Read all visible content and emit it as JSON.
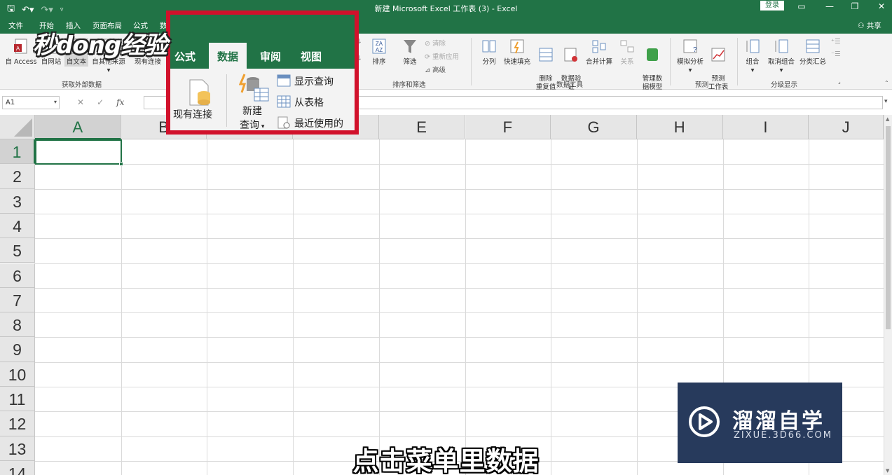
{
  "window": {
    "title": "新建 Microsoft Excel 工作表 (3)  -  Excel",
    "login_label": "登录"
  },
  "tabs": [
    "文件",
    "开始",
    "插入",
    "页面布局",
    "公式",
    "数据",
    "审阅",
    "视图"
  ],
  "share_label": "共享",
  "ribbon": {
    "get_external": {
      "buttons": [
        "自 Access",
        "自网站",
        "自文本",
        "自其他来源",
        "现有连接"
      ],
      "group_label": "获取外部数据"
    },
    "sort_filter": {
      "sort": "排序",
      "filter": "筛选",
      "clear": "清除",
      "reapply": "重新应用",
      "advanced": "高级",
      "group_label": "排序和筛选"
    },
    "data_tools": {
      "buttons": [
        "分列",
        "快速填充",
        "删除\n重复值",
        "数据验\n证",
        "合并计算",
        "关系",
        "管理数\n据模型"
      ],
      "group_label": "数据工具"
    },
    "forecast": {
      "buttons": [
        "模拟分析",
        "预测\n工作表"
      ],
      "group_label": "预测"
    },
    "outline": {
      "buttons": [
        "组合",
        "取消组合",
        "分类汇总"
      ],
      "group_label": "分级显示"
    }
  },
  "formula_bar": {
    "name_box": "A1",
    "fx": "fx",
    "value": ""
  },
  "sheet": {
    "columns": [
      "A",
      "B",
      "C",
      "D",
      "E",
      "F",
      "G",
      "H",
      "I",
      "J"
    ],
    "rows": [
      "1",
      "2",
      "3",
      "4",
      "5",
      "6",
      "7",
      "8",
      "9",
      "10",
      "11",
      "12",
      "13",
      "14"
    ],
    "active_cell": "A1"
  },
  "zoom": {
    "tabs": [
      "公式",
      "数据",
      "审阅",
      "视图"
    ],
    "existing_connections": "现有连接",
    "new_query_line1": "新建",
    "new_query_line2": "查询",
    "show_queries": "显示查询",
    "from_table": "从表格",
    "recent_sources": "最近使用的"
  },
  "watermarks": {
    "top_left": "秒dong经验",
    "brand_name": "溜溜自学",
    "brand_url": "ZIXUE.3D66.COM"
  },
  "caption": "点击菜单里数据",
  "colors": {
    "excel_green": "#217346",
    "highlight_red": "#d1112b",
    "brand_bg": "#273a5c"
  }
}
